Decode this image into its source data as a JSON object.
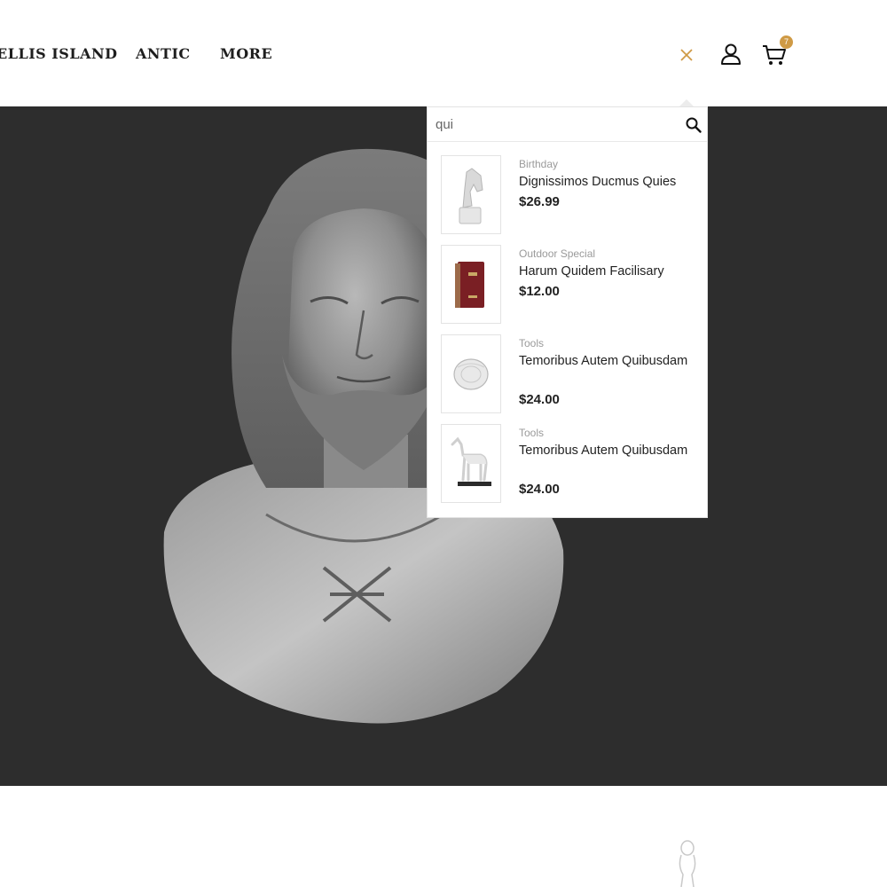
{
  "nav": {
    "items": [
      "ELLIS ISLAND",
      "ANTIC",
      "MORE"
    ]
  },
  "header": {
    "cart_count": "7",
    "accent_color": "#cf9a45"
  },
  "icons": {
    "close": "close-icon",
    "user": "user-icon",
    "cart": "cart-icon",
    "search": "search-icon"
  },
  "search": {
    "value": "qui",
    "results": [
      {
        "category": "Birthday",
        "title": "Dignissimos Ducmus Quies",
        "price": "$26.99",
        "thumb": "horse-head-bust"
      },
      {
        "category": "Outdoor Special",
        "title": "Harum Quidem Facilisary",
        "price": "$12.00",
        "thumb": "red-book"
      },
      {
        "category": "Tools",
        "title": "Temoribus Autem Quibusdam",
        "price": "$24.00",
        "thumb": "silver-ornament"
      },
      {
        "category": "Tools",
        "title": "Temoribus Autem Quibusdam",
        "price": "$24.00",
        "thumb": "horse-statue"
      }
    ]
  },
  "hero": {
    "background_color": "#2d2d2d",
    "image": "bust-sculpture"
  }
}
